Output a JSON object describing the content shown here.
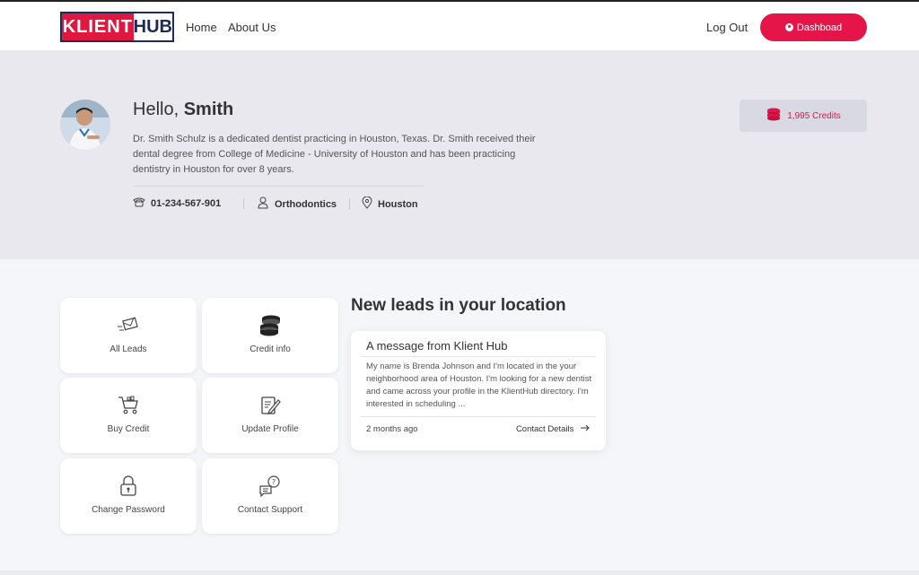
{
  "header": {
    "logo_part1": "KLIENT",
    "logo_part2": "HUB",
    "nav": [
      "Home",
      "About Us"
    ],
    "logout": "Log Out",
    "dashboard": "Dashboad"
  },
  "profile": {
    "greeting": "Hello, ",
    "name": "Smith",
    "bio": "Dr. Smith Schulz is a dedicated dentist practicing in Houston, Texas. Dr. Smith received their dental degree from College of Medicine - University of Houston and has been practicing dentistry in Houston for over 8 years.",
    "phone": "01-234-567-901",
    "specialty": "Orthodontics",
    "location": "Houston",
    "credits": "1,995 Credits"
  },
  "tiles": [
    {
      "label": "All Leads",
      "icon": "envelope-icon"
    },
    {
      "label": "Credit info",
      "icon": "coins-icon"
    },
    {
      "label": "Buy Credit",
      "icon": "cart-icon"
    },
    {
      "label": "Update Profile",
      "icon": "edit-document-icon"
    },
    {
      "label": "Change Password",
      "icon": "lock-icon"
    },
    {
      "label": "Contact Support",
      "icon": "support-chat-icon"
    }
  ],
  "leads": {
    "title": "New leads in your location",
    "card": {
      "heading": "A message from Klient Hub",
      "body": "My name is Brenda Johnson and I'm located in the your neighborhood area of Houston. I'm looking for a new dentist and came across your profile in the KlientHub directory. I'm interested in scheduling ...",
      "time": "2 months ago",
      "link": "Contact Details"
    }
  },
  "colors": {
    "brand": "#e5154a",
    "navy": "#1d2c56"
  }
}
